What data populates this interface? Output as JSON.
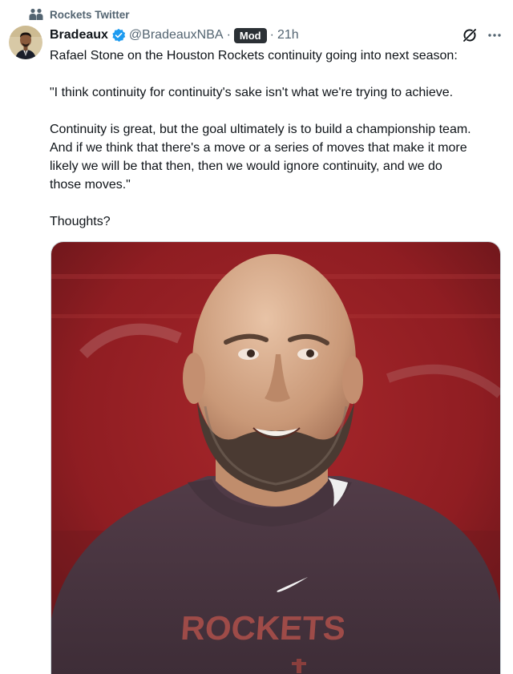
{
  "community": {
    "name": "Rockets Twitter",
    "icon": "community-icon"
  },
  "author": {
    "display_name": "Bradeaux",
    "handle": "@BradeauxNBA",
    "verified_icon": "verified-badge-icon",
    "verified_color": "#1d9bf0"
  },
  "meta": {
    "separator": "·",
    "badge": "Mod",
    "time": "21h"
  },
  "actions": {
    "grok_icon": "grok-icon",
    "more_icon": "more-icon"
  },
  "tweet": {
    "line1": "Rafael Stone on the Houston Rockets continuity going into next season:",
    "line2": "\"I think continuity for continuity's sake isn't what we're trying to achieve.",
    "line3a": "Continuity is great, but the goal ultimately is to build a championship team.",
    "line3b": "And if we think that there's a move or a series of moves that make it more",
    "line3c": "likely we will be that then, then we would ignore continuity, and we do",
    "line3d": "those moves.\"",
    "line4": "Thoughts?"
  },
  "media": {
    "shirt_text": "ROCKETS",
    "background_color": "#9a1f23",
    "shirt_color": "#4a3641"
  }
}
